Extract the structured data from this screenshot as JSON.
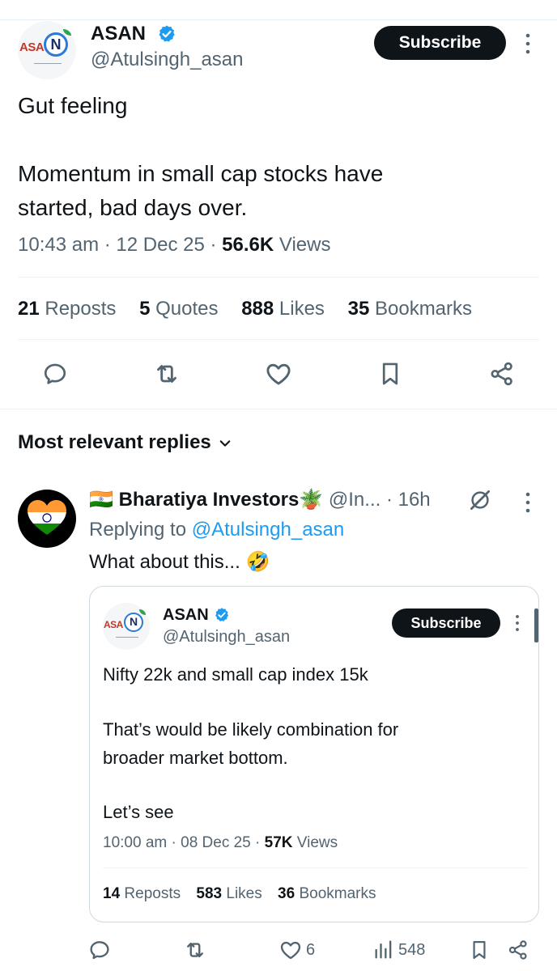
{
  "post": {
    "author": {
      "name": "ASAN",
      "handle": "@Atulsingh_asan",
      "logo_text": "ASA",
      "logo_letter": "N"
    },
    "subscribe_label": "Subscribe",
    "text_lines": [
      "Gut feeling",
      "",
      "Momentum in small cap stocks have",
      "started, bad days over."
    ],
    "time": "10:43 am",
    "date": "12 Dec 25",
    "views_count": "56.6K",
    "views_label": "Views",
    "stats": [
      {
        "count": "21",
        "label": "Reposts"
      },
      {
        "count": "5",
        "label": "Quotes"
      },
      {
        "count": "888",
        "label": "Likes"
      },
      {
        "count": "35",
        "label": "Bookmarks"
      }
    ],
    "actions": [
      "reply-icon",
      "repost-icon",
      "like-icon",
      "bookmark-icon",
      "share-icon"
    ]
  },
  "replies_sort_label": "Most relevant replies",
  "reply": {
    "flag": "🇮🇳",
    "name": "Bharatiya Investors",
    "name_emoji": "🪴",
    "handle": "@In...",
    "time": "· 16h",
    "replying_prefix": "Replying to",
    "replying_to": "@Atulsingh_asan",
    "text": "What about this...",
    "text_emoji": "🤣",
    "quote": {
      "author_name": "ASAN",
      "author_handle": "@Atulsingh_asan",
      "subscribe_label": "Subscribe",
      "text_lines": [
        "Nifty 22k and small cap index 15k",
        "",
        "That’s would be likely combination for",
        "broader market bottom.",
        "",
        "Let’s see"
      ],
      "time": "10:00 am",
      "date": "08 Dec 25",
      "views_count": "57K",
      "views_label": "Views",
      "stats": [
        {
          "count": "14",
          "label": "Reposts"
        },
        {
          "count": "583",
          "label": "Likes"
        },
        {
          "count": "36",
          "label": "Bookmarks"
        }
      ]
    },
    "likes": "6",
    "views": "548"
  },
  "colors": {
    "accent": "#1d9bf0",
    "text": "#0f1419",
    "secondary": "#536471",
    "verified": "#1d9bf0",
    "button": "#0f1419"
  }
}
